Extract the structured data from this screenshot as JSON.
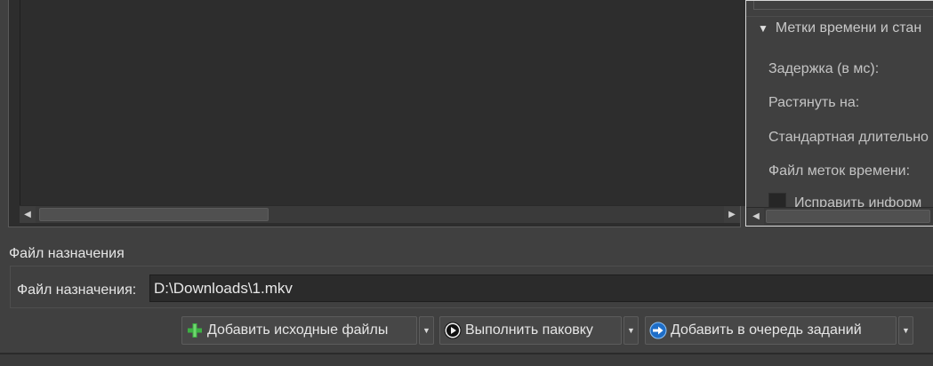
{
  "right_panel": {
    "section_title": "Метки времени и стан",
    "options": [
      {
        "label": "Задержка (в мс):"
      },
      {
        "label": "Растянуть на:"
      },
      {
        "label": "Стандартная длительно"
      },
      {
        "label": "Файл меток времени:"
      }
    ],
    "checkbox_label": "Исправить информ"
  },
  "destination": {
    "section_title": "Файл назначения",
    "field_label": "Файл назначения:",
    "field_value": "D:\\Downloads\\1.mkv"
  },
  "actions": {
    "add_source_files": "Добавить исходные файлы",
    "start_muxing": "Выполнить паковку",
    "add_to_queue": "Добавить в очередь заданий"
  },
  "icons": {
    "add_source_files": "green-plus-icon",
    "start_muxing": "play-circle-icon",
    "add_to_queue": "blue-arrow-queue-icon",
    "dropdown": "triangle-down-icon",
    "section_toggle": "triangle-down-icon"
  },
  "colors": {
    "background": "#404040",
    "panel_dark": "#2d2d2d",
    "accent_green": "#3cb043",
    "accent_blue": "#1e6ec8"
  }
}
